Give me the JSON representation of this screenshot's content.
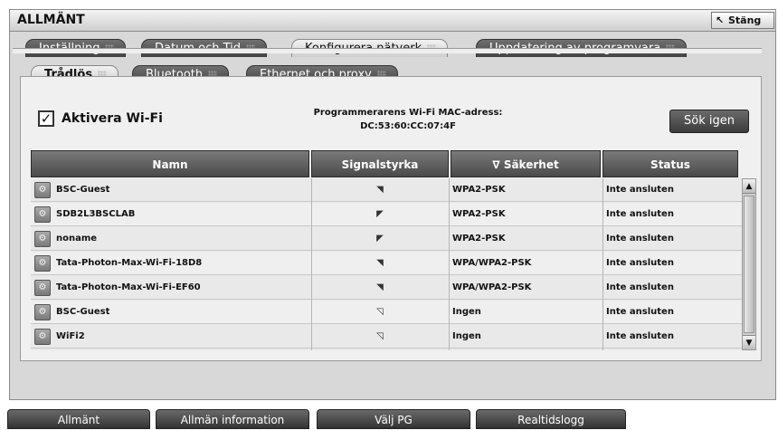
{
  "window": {
    "title": "ALLMÄNT",
    "close_label": "Stäng"
  },
  "tabs_primary": [
    {
      "label": "Inställning",
      "active": false
    },
    {
      "label": "Datum och Tid",
      "active": false
    },
    {
      "label": "Konfigurera nätverk",
      "active": true
    },
    {
      "label": "Uppdatering av programvara",
      "active": false
    }
  ],
  "tabs_secondary": [
    {
      "label": "Trådlös",
      "active": true
    },
    {
      "label": "Bluetooth",
      "active": false
    },
    {
      "label": "Ethernet och proxy",
      "active": false
    }
  ],
  "wifi": {
    "checkbox_checked": true,
    "checkmark": "✓",
    "label": "Aktivera Wi-Fi",
    "mac_label": "Programmerarens Wi-Fi MAC-adress:",
    "mac_value": "DC:53:60:CC:07:4F",
    "search_label": "Sök igen"
  },
  "table": {
    "columns": [
      {
        "label": "Namn"
      },
      {
        "label": "Signalstyrka"
      },
      {
        "label": "∇ Säkerhet"
      },
      {
        "label": "Status"
      }
    ],
    "rows": [
      {
        "name": "BSC-Guest",
        "signal": "wifi-strong-icon",
        "security": "WPA2-PSK",
        "status": "Inte ansluten"
      },
      {
        "name": "SDB2L3BSCLAB",
        "signal": "wifi-medium-icon",
        "security": "WPA2-PSK",
        "status": "Inte ansluten"
      },
      {
        "name": "noname",
        "signal": "wifi-medium-icon",
        "security": "WPA2-PSK",
        "status": "Inte ansluten"
      },
      {
        "name": "Tata-Photon-Max-Wi-Fi-18D8",
        "signal": "wifi-strong-icon",
        "security": "WPA/WPA2-PSK",
        "status": "Inte ansluten"
      },
      {
        "name": "Tata-Photon-Max-Wi-Fi-EF60",
        "signal": "wifi-strong-icon",
        "security": "WPA/WPA2-PSK",
        "status": "Inte ansluten"
      },
      {
        "name": "BSC-Guest",
        "signal": "wifi-weak-icon",
        "security": "Ingen",
        "status": "Inte ansluten"
      },
      {
        "name": "WiFi2",
        "signal": "wifi-weak-icon",
        "security": "Ingen",
        "status": "Inte ansluten"
      }
    ]
  },
  "bottom_nav": [
    {
      "label": "Allmänt"
    },
    {
      "label": "Allmän information"
    },
    {
      "label": "Välj PG"
    },
    {
      "label": "Realtidslogg"
    }
  ],
  "colors": {
    "header_dark": "#4a4a4a",
    "tab_active": "#e0e0e0",
    "row_bg": "#e9e9e9"
  }
}
